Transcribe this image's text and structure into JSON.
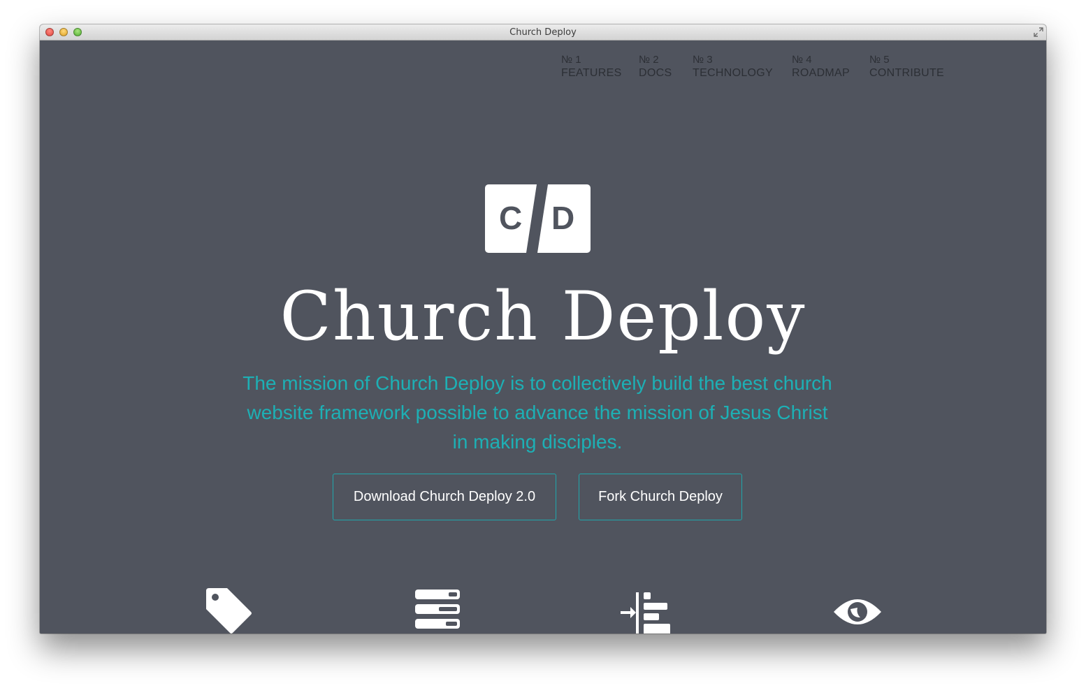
{
  "window": {
    "title": "Church Deploy"
  },
  "nav": {
    "items": [
      {
        "num": "№ 1",
        "label": "FEATURES"
      },
      {
        "num": "№ 2",
        "label": "DOCS"
      },
      {
        "num": "№ 3",
        "label": "TECHNOLOGY"
      },
      {
        "num": "№ 4",
        "label": "ROADMAP"
      },
      {
        "num": "№ 5",
        "label": "CONTRIBUTE"
      }
    ]
  },
  "logo": {
    "left_letter": "C",
    "right_letter": "D"
  },
  "hero": {
    "title": "Church Deploy",
    "mission": "The mission of Church Deploy is to collectively build the best church website framework possible to advance the mission of Jesus Christ in making disciples."
  },
  "buttons": {
    "download": "Download Church Deploy 2.0",
    "fork": "Fork Church Deploy"
  },
  "features": {
    "icons": [
      "tag-icon",
      "server-stack-icon",
      "indent-list-icon",
      "eye-icon"
    ]
  },
  "colors": {
    "background": "#50545e",
    "accent": "#1db0b5",
    "nav_text": "#2c2f35",
    "title_text": "#ffffff"
  }
}
